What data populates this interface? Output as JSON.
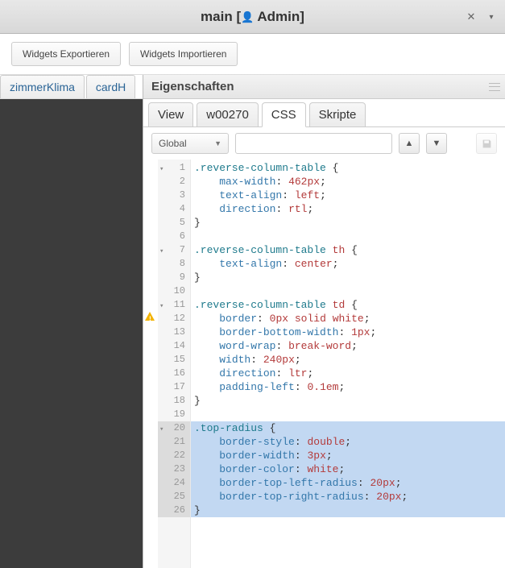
{
  "titlebar": {
    "title_prefix": "main [",
    "title_user": "Admin",
    "title_suffix": "]"
  },
  "topbar": {
    "export_label": "Widgets Exportieren",
    "import_label": "Widgets Importieren"
  },
  "view_tabs": {
    "tab1": "zimmerKlima",
    "tab2": "cardH"
  },
  "panel": {
    "header": "Eigenschaften"
  },
  "prop_tabs": {
    "view": "View",
    "widget": "w00270",
    "css": "CSS",
    "scripts": "Skripte"
  },
  "toolbar": {
    "dropdown_value": "Global",
    "search_value": ""
  },
  "code": {
    "lines": [
      {
        "n": 1,
        "fold": true,
        "warn": false,
        "sel": false,
        "html": "<span class='sel-class'>.reverse-column-table</span> <span class='brace'>{</span>"
      },
      {
        "n": 2,
        "fold": false,
        "warn": false,
        "sel": false,
        "html": "    <span class='prop'>max-width</span><span class='punc'>:</span> <span class='num'>462px</span><span class='punc'>;</span>"
      },
      {
        "n": 3,
        "fold": false,
        "warn": false,
        "sel": false,
        "html": "    <span class='prop'>text-align</span><span class='punc'>:</span> <span class='kw'>left</span><span class='punc'>;</span>"
      },
      {
        "n": 4,
        "fold": false,
        "warn": false,
        "sel": false,
        "html": "    <span class='prop'>direction</span><span class='punc'>:</span> <span class='kw'>rtl</span><span class='punc'>;</span>"
      },
      {
        "n": 5,
        "fold": false,
        "warn": false,
        "sel": false,
        "html": "<span class='brace'>}</span>"
      },
      {
        "n": 6,
        "fold": false,
        "warn": false,
        "sel": false,
        "html": ""
      },
      {
        "n": 7,
        "fold": true,
        "warn": false,
        "sel": false,
        "html": "<span class='sel-class'>.reverse-column-table</span> <span class='sel-tag'>th</span> <span class='brace'>{</span>"
      },
      {
        "n": 8,
        "fold": false,
        "warn": false,
        "sel": false,
        "html": "    <span class='prop'>text-align</span><span class='punc'>:</span> <span class='kw'>center</span><span class='punc'>;</span>"
      },
      {
        "n": 9,
        "fold": false,
        "warn": false,
        "sel": false,
        "html": "<span class='brace'>}</span>"
      },
      {
        "n": 10,
        "fold": false,
        "warn": false,
        "sel": false,
        "html": ""
      },
      {
        "n": 11,
        "fold": true,
        "warn": false,
        "sel": false,
        "html": "<span class='sel-class'>.reverse-column-table</span> <span class='sel-tag'>td</span> <span class='brace'>{</span>"
      },
      {
        "n": 12,
        "fold": false,
        "warn": true,
        "sel": false,
        "html": "    <span class='prop'>border</span><span class='punc'>:</span> <span class='num'>0px</span> <span class='kw'>solid</span> <span class='kw'>white</span><span class='punc'>;</span>"
      },
      {
        "n": 13,
        "fold": false,
        "warn": false,
        "sel": false,
        "html": "    <span class='prop'>border-bottom-width</span><span class='punc'>:</span> <span class='num'>1px</span><span class='punc'>;</span>"
      },
      {
        "n": 14,
        "fold": false,
        "warn": false,
        "sel": false,
        "html": "    <span class='prop'>word-wrap</span><span class='punc'>:</span> <span class='kw'>break-word</span><span class='punc'>;</span>"
      },
      {
        "n": 15,
        "fold": false,
        "warn": false,
        "sel": false,
        "html": "    <span class='prop'>width</span><span class='punc'>:</span> <span class='num'>240px</span><span class='punc'>;</span>"
      },
      {
        "n": 16,
        "fold": false,
        "warn": false,
        "sel": false,
        "html": "    <span class='prop'>direction</span><span class='punc'>:</span> <span class='kw'>ltr</span><span class='punc'>;</span>"
      },
      {
        "n": 17,
        "fold": false,
        "warn": false,
        "sel": false,
        "html": "    <span class='prop'>padding-left</span><span class='punc'>:</span> <span class='num'>0.1em</span><span class='punc'>;</span>"
      },
      {
        "n": 18,
        "fold": false,
        "warn": false,
        "sel": false,
        "html": "<span class='brace'>}</span>"
      },
      {
        "n": 19,
        "fold": false,
        "warn": false,
        "sel": false,
        "html": ""
      },
      {
        "n": 20,
        "fold": true,
        "warn": false,
        "sel": true,
        "html": "<span class='sel-class'>.top-radius</span> <span class='brace'>{</span>"
      },
      {
        "n": 21,
        "fold": false,
        "warn": false,
        "sel": true,
        "html": "    <span class='prop'>border-style</span><span class='punc'>:</span> <span class='kw'>double</span><span class='punc'>;</span>"
      },
      {
        "n": 22,
        "fold": false,
        "warn": false,
        "sel": true,
        "html": "    <span class='prop'>border-width</span><span class='punc'>:</span> <span class='num'>3px</span><span class='punc'>;</span>"
      },
      {
        "n": 23,
        "fold": false,
        "warn": false,
        "sel": true,
        "html": "    <span class='prop'>border-color</span><span class='punc'>:</span> <span class='kw'>white</span><span class='punc'>;</span>"
      },
      {
        "n": 24,
        "fold": false,
        "warn": false,
        "sel": true,
        "html": "    <span class='prop'>border-top-left-radius</span><span class='punc'>:</span> <span class='num'>20px</span><span class='punc'>;</span>"
      },
      {
        "n": 25,
        "fold": false,
        "warn": false,
        "sel": true,
        "html": "    <span class='prop'>border-top-right-radius</span><span class='punc'>:</span> <span class='num'>20px</span><span class='punc'>;</span>"
      },
      {
        "n": 26,
        "fold": false,
        "warn": false,
        "sel": true,
        "html": "<span class='brace'>}</span>"
      }
    ]
  }
}
